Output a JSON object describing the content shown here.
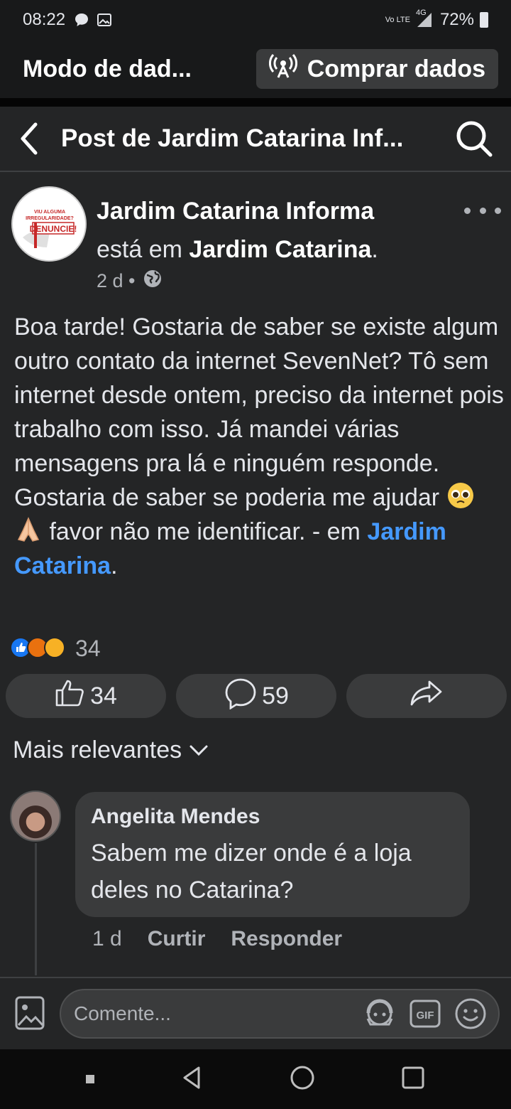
{
  "status_bar": {
    "time": "08:22",
    "network_label": "Vo LTE",
    "network_type": "4G",
    "battery": "72%"
  },
  "data_bar": {
    "mode_label": "Modo de dad...",
    "buy_label": "Comprar dados"
  },
  "nav": {
    "title": "Post de Jardim Catarina Inf..."
  },
  "post": {
    "page_name": "Jardim Catarina Informa",
    "location_prefix": "está em ",
    "location_name": "Jardim Catarina",
    "location_suffix": ".",
    "time_ago": "2 d •",
    "avatar_text_top": "VIU ALGUMA IRREGULARIDADE?",
    "avatar_text_bottom": "DENUNCIE!",
    "body_text": "Boa tarde! Gostaria de saber se existe algum outro contato da internet SevenNet? Tô sem internet desde ontem, preciso da internet pois trabalho com isso. Já mandei várias mensagens pra lá e ninguém responde. Gostaria de saber se poderia me ajudar",
    "body_after_emoji": " favor não me identificar. - em ",
    "body_link": "Jardim Catarina",
    "body_end": ".",
    "reaction_count": "34",
    "like_count": "34",
    "comment_count": "59"
  },
  "comments": {
    "sort_label": "Mais relevantes",
    "items": [
      {
        "author": "Angelita Mendes",
        "text": "Sabem me dizer onde é a loja deles no Catarina?",
        "time": "1 d",
        "like_label": "Curtir",
        "reply_label": "Responder"
      }
    ]
  },
  "composer": {
    "placeholder": "Comente..."
  },
  "colors": {
    "background": "#242526",
    "surface": "#3a3b3c",
    "link": "#4599ff",
    "text_secondary": "#b0b3b8"
  },
  "icons": [
    "chat-bubble-icon",
    "image-icon",
    "back-chevron-icon",
    "search-icon",
    "globe-icon",
    "like-icon",
    "comment-icon",
    "share-icon",
    "chevron-down-icon",
    "photo-icon",
    "avatar-sticker-icon",
    "gif-icon",
    "emoji-icon"
  ]
}
